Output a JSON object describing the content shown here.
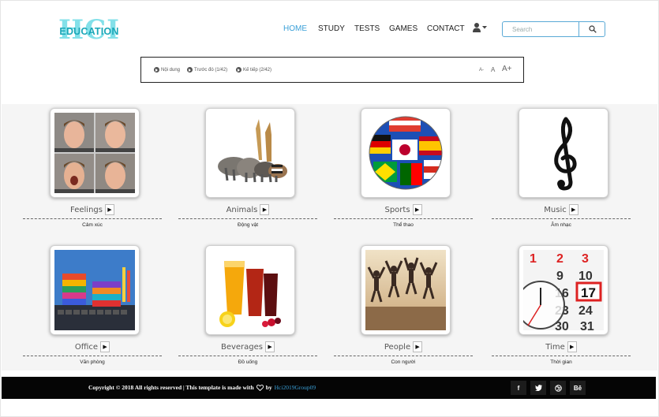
{
  "brand": {
    "logo_big": "HCI",
    "logo_small": "EDUCATION"
  },
  "nav": {
    "items": [
      {
        "label": "HOME",
        "active": true
      },
      {
        "label": "STUDY"
      },
      {
        "label": "TESTS"
      },
      {
        "label": "GAMES"
      },
      {
        "label": "CONTACT"
      }
    ],
    "user_icon": "user-dropdown-icon",
    "search_placeholder": "Search",
    "search_icon": "search-icon"
  },
  "toolbar": {
    "content_label": "Nội dung",
    "prev_label": "Trước đó (1/42)",
    "next_label": "Kế tiếp (2/42)",
    "font_small": "A-",
    "font_normal": "A",
    "font_large": "A+"
  },
  "categories": [
    {
      "label": "Feelings",
      "sub": "Cảm xúc",
      "icon": "faces-photo"
    },
    {
      "label": "Animals",
      "sub": "Động vật",
      "icon": "animals-photo"
    },
    {
      "label": "Sports",
      "sub": "Thể thao",
      "icon": "flag-ball-photo"
    },
    {
      "label": "Music",
      "sub": "Âm nhạc",
      "icon": "treble-clef"
    },
    {
      "label": "Office",
      "sub": "Văn phòng",
      "icon": "office-books-photo"
    },
    {
      "label": "Beverages",
      "sub": "Đồ uống",
      "icon": "drinks-photo"
    },
    {
      "label": "People",
      "sub": "Con người",
      "icon": "people-jumping-photo"
    },
    {
      "label": "Time",
      "sub": "Thời gian",
      "icon": "clock-calendar-photo"
    }
  ],
  "play_icon": "▶",
  "footer": {
    "copyright": "Copyright © 2018 All rights reserved | This template is made with",
    "by": "by",
    "author": "Hci2019Group09",
    "social": [
      "f",
      "🐦",
      "⊛",
      "Bē"
    ],
    "social_names": [
      "facebook-icon",
      "twitter-icon",
      "dribbble-icon",
      "behance-icon"
    ]
  },
  "colors": {
    "accent": "#3aa0d8",
    "logo": "#1ec8d8",
    "footer_bg": "#050505"
  }
}
